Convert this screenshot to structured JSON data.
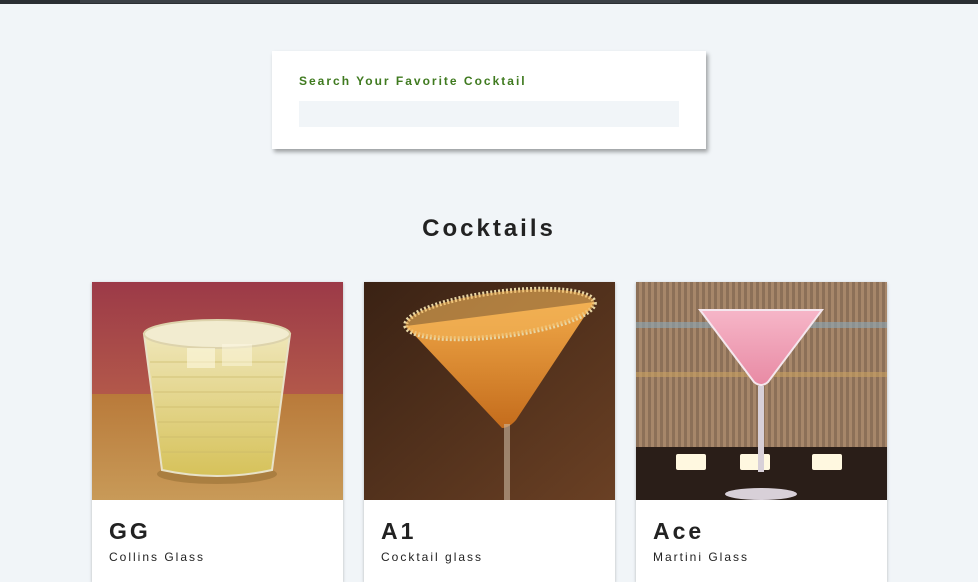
{
  "search": {
    "label": "Search Your Favorite Cocktail",
    "value": "",
    "placeholder": ""
  },
  "section": {
    "title": "Cocktails"
  },
  "cocktails": [
    {
      "name": "GG",
      "glass": "Collins Glass"
    },
    {
      "name": "A1",
      "glass": "Cocktail glass"
    },
    {
      "name": "Ace",
      "glass": "Martini Glass"
    }
  ],
  "colors": {
    "background": "#f1f5f8",
    "accent": "#3f7a1f",
    "text": "#222222"
  }
}
